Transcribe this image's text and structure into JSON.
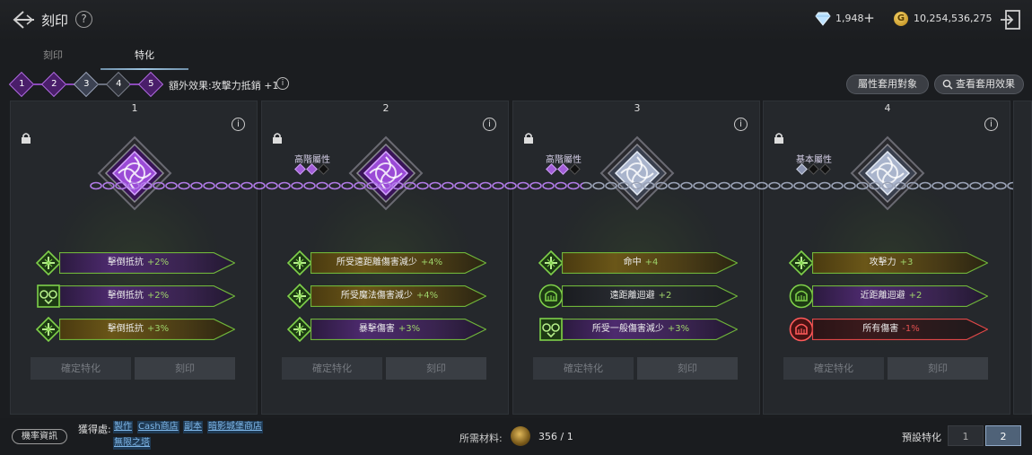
{
  "header": {
    "title": "刻印",
    "help": "?",
    "gems": "1,948",
    "gold_symbol": "G",
    "gold": "10,254,536,275"
  },
  "tabs": [
    "刻印",
    "特化"
  ],
  "active_tab": 1,
  "stages": [
    "1",
    "2",
    "3",
    "4",
    "5"
  ],
  "bonus_text": "額外效果:攻擊力抵銷 +1",
  "info_glyph": "i",
  "buttons": {
    "attr_apply": "屬性套用對象",
    "view_effect": "查看套用效果"
  },
  "cards": [
    {
      "num": "1",
      "attr_label": "",
      "rows": [
        {
          "name": "擊倒抵抗",
          "value": "+2%"
        },
        {
          "name": "擊倒抵抗",
          "value": "+2%"
        },
        {
          "name": "擊倒抵抗",
          "value": "+3%"
        }
      ],
      "confirm": "確定特化",
      "engrave": "刻印"
    },
    {
      "num": "2",
      "attr_label": "高階屬性",
      "rows": [
        {
          "name": "所受遠距離傷害減少",
          "value": "+4%"
        },
        {
          "name": "所受魔法傷害減少",
          "value": "+4%"
        },
        {
          "name": "暴擊傷害",
          "value": "+3%"
        }
      ],
      "confirm": "確定特化",
      "engrave": "刻印"
    },
    {
      "num": "3",
      "attr_label": "高階屬性",
      "rows": [
        {
          "name": "命中",
          "value": "+4"
        },
        {
          "name": "遠距離迴避",
          "value": "+2"
        },
        {
          "name": "所受一般傷害減少",
          "value": "+3%"
        }
      ],
      "confirm": "確定特化",
      "engrave": "刻印"
    },
    {
      "num": "4",
      "attr_label": "基本屬性",
      "rows": [
        {
          "name": "攻擊力",
          "value": "+3"
        },
        {
          "name": "近距離迴避",
          "value": "+2"
        },
        {
          "name": "所有傷害",
          "value": "-1%"
        }
      ],
      "confirm": "確定特化",
      "engrave": "刻印"
    }
  ],
  "footer": {
    "rate_info": "機率資訊",
    "source_label": "獲得處:",
    "sources": [
      "製作",
      "Cash商店",
      "副本",
      "暗影城堡商店",
      "無限之塔"
    ],
    "material_label": "所需材料:",
    "material_count": "356 / 1",
    "preset_label": "預設特化",
    "presets": [
      "1",
      "2"
    ],
    "active_preset": 1
  },
  "colors": {
    "purple_accent": "#a25cd8",
    "green_accent": "#6fb43a",
    "gold_accent": "#d4a53a",
    "red_accent": "#e25050",
    "link_blue": "#7fb8ea"
  }
}
